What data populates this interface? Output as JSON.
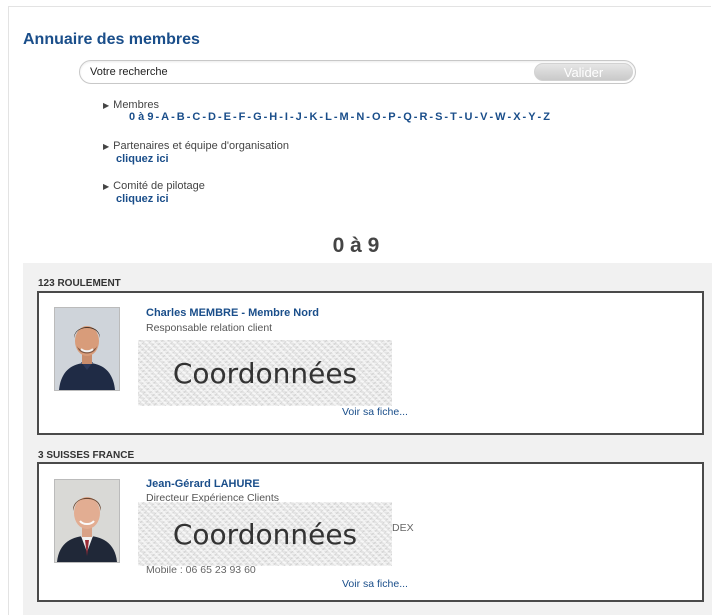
{
  "page": {
    "title": "Annuaire des membres"
  },
  "search": {
    "placeholder": "Votre recherche",
    "submit_label": "Valider"
  },
  "nav": {
    "members_label": "Membres",
    "alphabet": [
      "0 à 9",
      "A",
      "B",
      "C",
      "D",
      "E",
      "F",
      "G",
      "H",
      "I",
      "J",
      "K",
      "L",
      "M",
      "N",
      "O",
      "P",
      "Q",
      "R",
      "S",
      "T",
      "U",
      "V",
      "W",
      "X",
      "Y",
      "Z"
    ],
    "partners_label": "Partenaires et équipe d'organisation",
    "partners_link": "cliquez ici",
    "committee_label": "Comité de pilotage",
    "committee_link": "cliquez ici"
  },
  "section": {
    "heading": "0 à 9"
  },
  "results": [
    {
      "company": "123 ROULEMENT",
      "name": "Charles MEMBRE - Membre Nord",
      "role": "Responsable relation client",
      "coordinates_overlay": "Coordonnées",
      "profile_link": "Voir sa fiche..."
    },
    {
      "company": "3 SUISSES FRANCE",
      "name": "Jean-Gérard LAHURE",
      "role": "Directeur Expérience Clients",
      "partial_text": "DEX",
      "mobile": "Mobile : 06 65 23 93 60",
      "coordinates_overlay": "Coordonnées",
      "profile_link": "Voir sa fiche..."
    }
  ]
}
